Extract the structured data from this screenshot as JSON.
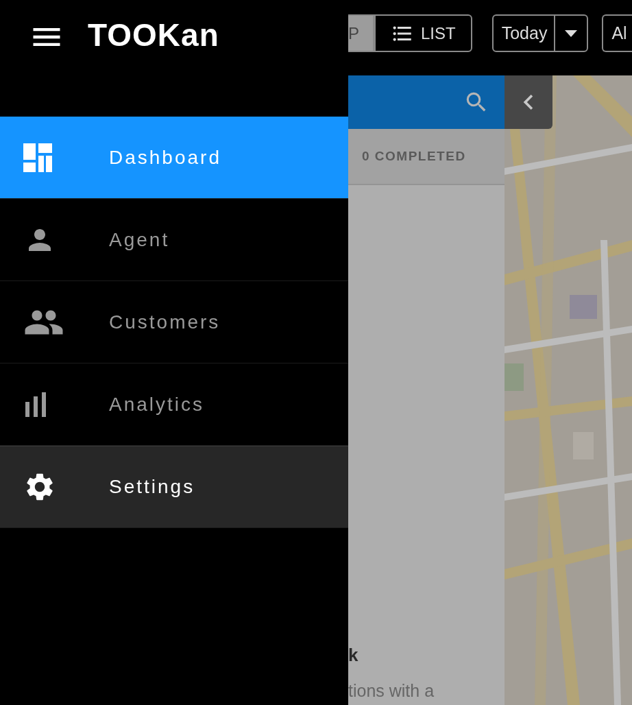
{
  "logo": "TOOKan",
  "sidebar": {
    "items": [
      {
        "label": "Dashboard",
        "kind": "dashboard",
        "selected": true,
        "hovered": false
      },
      {
        "label": "Agent",
        "kind": "agent",
        "selected": false,
        "hovered": false
      },
      {
        "label": "Customers",
        "kind": "customers",
        "selected": false,
        "hovered": false
      },
      {
        "label": "Analytics",
        "kind": "analytics",
        "selected": false,
        "hovered": false
      },
      {
        "label": "Settings",
        "kind": "settings",
        "selected": false,
        "hovered": true
      }
    ]
  },
  "top_bar": {
    "view_toggle": [
      {
        "label": "P",
        "kind": "map",
        "selected": true
      },
      {
        "label": "LIST",
        "kind": "list",
        "selected": false
      }
    ],
    "date_filter": "Today",
    "filter_partial": "Al"
  },
  "panel": {
    "tab": "0 COMPLETED",
    "heading": "k",
    "text": "tions with a"
  }
}
